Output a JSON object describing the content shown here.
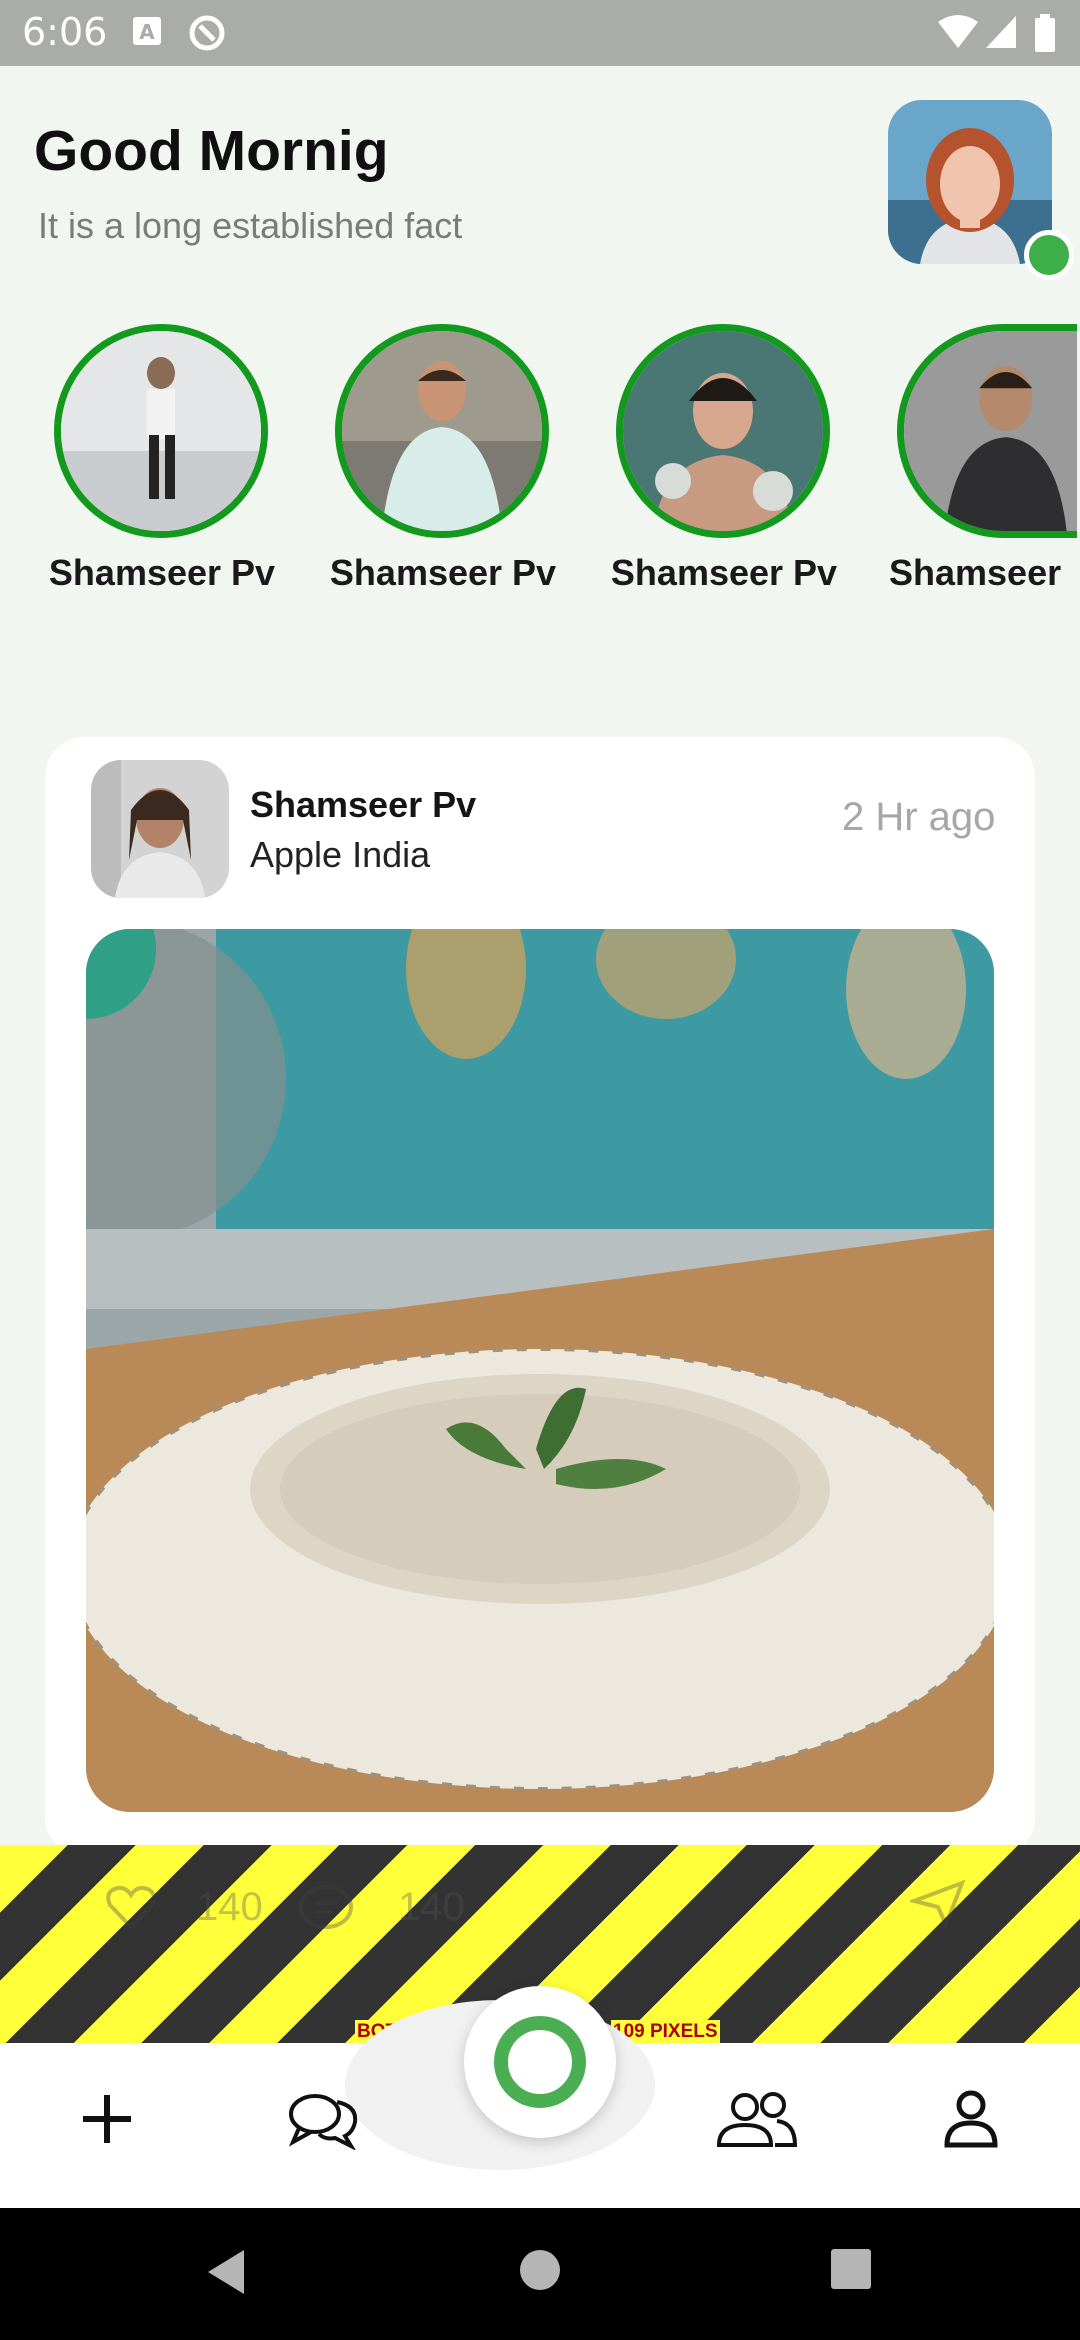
{
  "status_bar": {
    "time": "6:06"
  },
  "header": {
    "greeting": "Good Mornig",
    "subtitle": "It is a long established fact"
  },
  "stories": [
    {
      "name": "Shamseer Pv"
    },
    {
      "name": "Shamseer Pv"
    },
    {
      "name": "Shamseer Pv"
    },
    {
      "name": "Shamseer"
    }
  ],
  "post": {
    "author": "Shamseer Pv",
    "company": "Apple India",
    "time": "2 Hr ago",
    "likes": "140",
    "comments": "140"
  },
  "overflow_warning": {
    "left_text": "BOTTOM OV",
    "right_text": "109 PIXELS"
  },
  "colors": {
    "accent_green": "#139a1e",
    "online_green": "#3eae48",
    "fab_green": "#4cae52",
    "background": "#f2f6f1"
  },
  "nav_icons": [
    "plus-icon",
    "chat-icon",
    "record-icon",
    "group-icon",
    "profile-icon"
  ]
}
